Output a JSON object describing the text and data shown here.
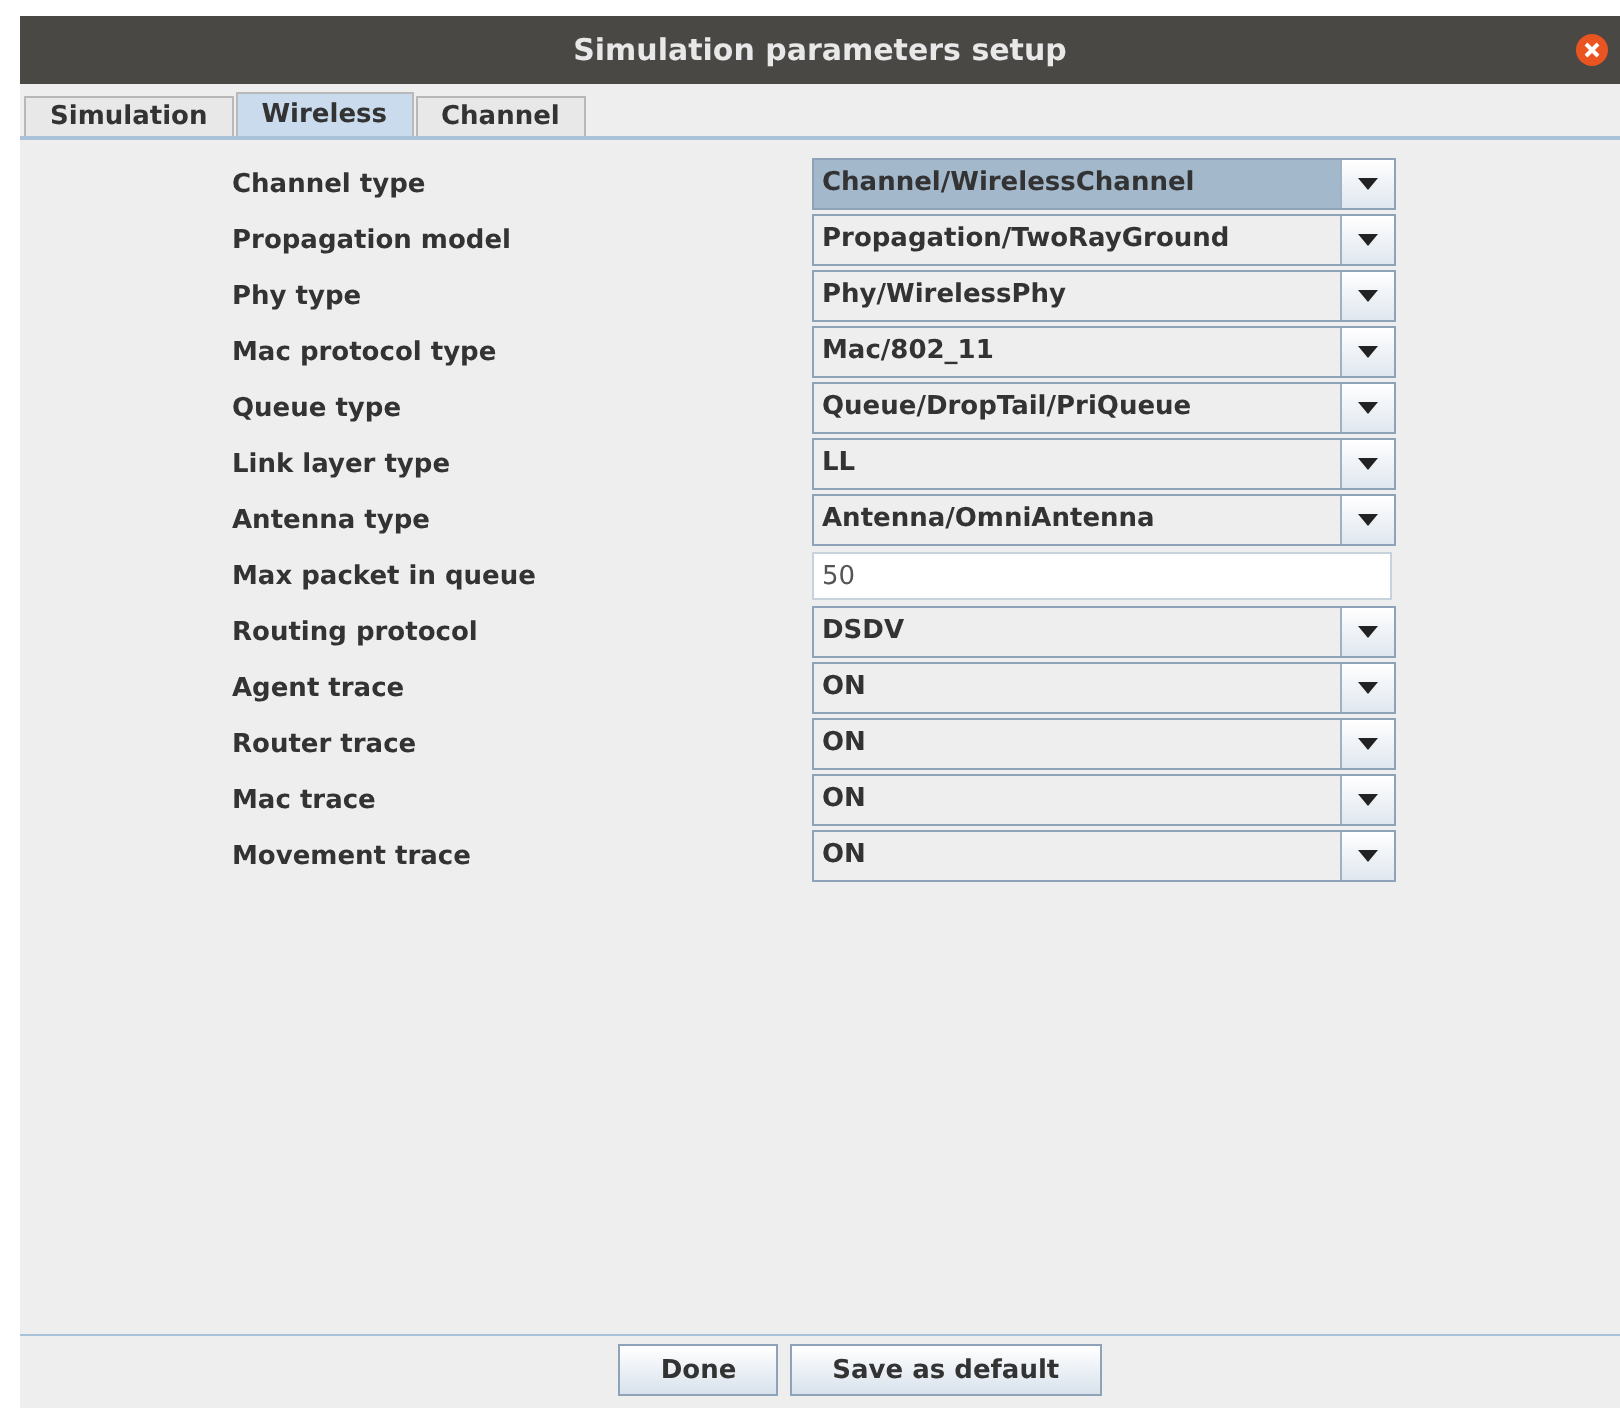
{
  "window": {
    "title": "Simulation parameters setup"
  },
  "tabs": [
    {
      "label": "Simulation",
      "selected": false
    },
    {
      "label": "Wireless",
      "selected": true
    },
    {
      "label": "Channel",
      "selected": false
    }
  ],
  "fields": [
    {
      "label": "Channel type",
      "kind": "combo",
      "value": "Channel/WirelessChannel",
      "focused": true
    },
    {
      "label": "Propagation model",
      "kind": "combo",
      "value": "Propagation/TwoRayGround",
      "focused": false
    },
    {
      "label": "Phy type",
      "kind": "combo",
      "value": "Phy/WirelessPhy",
      "focused": false
    },
    {
      "label": "Mac protocol type",
      "kind": "combo",
      "value": "Mac/802_11",
      "focused": false
    },
    {
      "label": "Queue type",
      "kind": "combo",
      "value": "Queue/DropTail/PriQueue",
      "focused": false
    },
    {
      "label": "Link layer type",
      "kind": "combo",
      "value": "LL",
      "focused": false
    },
    {
      "label": "Antenna type",
      "kind": "combo",
      "value": "Antenna/OmniAntenna",
      "focused": false
    },
    {
      "label": "Max packet in queue",
      "kind": "text",
      "value": "50"
    },
    {
      "label": "Routing protocol",
      "kind": "combo",
      "value": "DSDV",
      "focused": false
    },
    {
      "label": "Agent trace",
      "kind": "combo",
      "value": "ON",
      "focused": false
    },
    {
      "label": "Router trace",
      "kind": "combo",
      "value": "ON",
      "focused": false
    },
    {
      "label": "Mac trace",
      "kind": "combo",
      "value": "ON",
      "focused": false
    },
    {
      "label": "Movement trace",
      "kind": "combo",
      "value": "ON",
      "focused": false
    }
  ],
  "buttons": [
    "Done",
    "Save as default"
  ]
}
